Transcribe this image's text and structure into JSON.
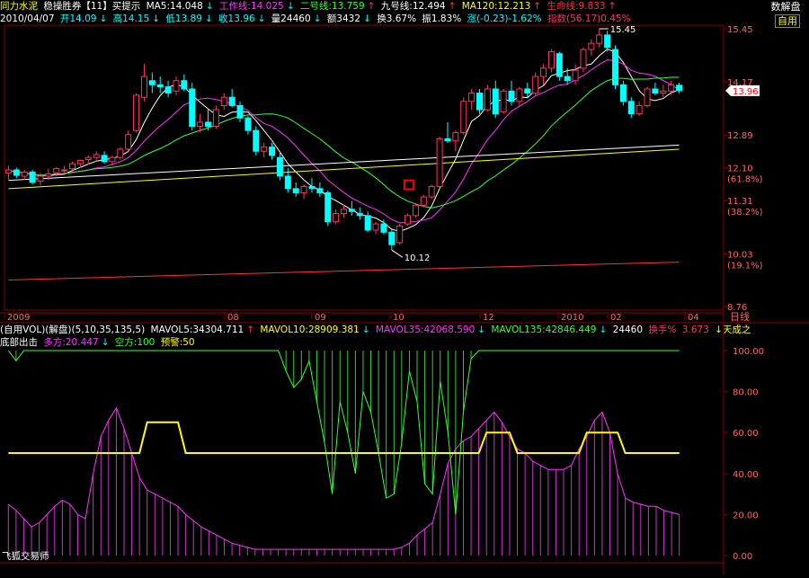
{
  "header": {
    "stock_name": "同力水泥",
    "indicator": "稳操胜券【11】买提示",
    "ma5": "MA5:14.048",
    "ma5_arrow": "↓",
    "gongzuo": "工作线:14.025",
    "gongzuo_arrow": "↓",
    "erhao": "二号线:13.759",
    "erhao_arrow": "↑",
    "jiuhao": "九号线:12.494",
    "jiuhao_arrow": "↑",
    "ma120": "MA120:12.213",
    "ma120_arrow": "↑",
    "shengming": "生命线:9.833",
    "shengming_arrow": "↑"
  },
  "quote": {
    "date": "2010/04/07",
    "open": "开14.09",
    "open_arrow": "↓",
    "high": "高14.15",
    "high_arrow": "↓",
    "low": "低13.89",
    "low_arrow": "↓",
    "close": "收13.96",
    "close_arrow": "↓",
    "volume": "量24460",
    "vol_arrow": "↓",
    "amount": "额3432",
    "amount_arrow": "↓",
    "turnover": "换3.67%",
    "amplitude": "振1.83%",
    "change": "涨(-0.23)-1.62%",
    "index": "指数(56.17)0.45%"
  },
  "vol_header": {
    "label": "(自用VOL)(解盘)(5,10,35,135,5)",
    "mavol5": "MAVOL5:34304.711",
    "mavol5_arrow": "↑",
    "mavol10": "MAVOL10:28909.381",
    "mavol10_arrow": "↓",
    "mavol35": "MAVOL35:42068.590",
    "mavol35_arrow": "↓",
    "mavol135": "MAVOL135:42846.449",
    "mavol135_arrow": "↓",
    "vol": "24460",
    "turn": "换手%",
    "turn_val": "3.673",
    "done": "↓天成之"
  },
  "sub_header": {
    "title": "底部出击",
    "duofang": "多方:20.447",
    "duofang_arrow": "↓",
    "kongfang": "空方:100",
    "yujing": "预警:50"
  },
  "buttons": {
    "zixuan": "自用",
    "jiepan": "数解盘"
  },
  "footer": {
    "brand": "飞狐交易师"
  },
  "colors": {
    "up": "#ff3366",
    "down": "#00ffff",
    "ma5": "#ffffff",
    "ma10": "#ff33ff",
    "ma20": "#33ff33",
    "ma60": "#ffffff",
    "ma120": "#ffff00",
    "life": "#ff3333",
    "grid": "#880000"
  },
  "chart_data": [
    {
      "type": "candlestick",
      "y_ticks": [
        "15.45",
        "14.17",
        "12.89",
        "12.10",
        "11.31",
        "10.03",
        "8.76"
      ],
      "y_pct": [
        "(61.8%)",
        "(38.2%)",
        "(19.1%)"
      ],
      "ylim": [
        8.76,
        15.45
      ],
      "x_ticks": [
        "2009",
        "08",
        "09",
        "10",
        "12",
        "2010",
        "02",
        "04"
      ],
      "x_unit": "日线",
      "current_price": "13.96",
      "annotations": {
        "high": "15.45",
        "low": "10.12"
      },
      "candles": [
        [
          11.98,
          12.15,
          11.82,
          12.05
        ],
        [
          12.05,
          12.1,
          11.85,
          11.92
        ],
        [
          11.9,
          12.05,
          11.8,
          12.0
        ],
        [
          12.0,
          12.05,
          11.7,
          11.75
        ],
        [
          11.78,
          11.98,
          11.68,
          11.9
        ],
        [
          11.9,
          12.08,
          11.8,
          11.95
        ],
        [
          11.98,
          12.12,
          11.9,
          12.08
        ],
        [
          12.05,
          12.15,
          11.95,
          12.05
        ],
        [
          12.08,
          12.25,
          12.0,
          12.2
        ],
        [
          12.2,
          12.3,
          12.1,
          12.28
        ],
        [
          12.3,
          12.4,
          12.18,
          12.35
        ],
        [
          12.35,
          12.5,
          12.25,
          12.42
        ],
        [
          12.4,
          12.5,
          12.2,
          12.25
        ],
        [
          12.25,
          12.4,
          12.15,
          12.35
        ],
        [
          12.35,
          12.6,
          12.3,
          12.55
        ],
        [
          12.55,
          13.0,
          12.5,
          12.9
        ],
        [
          13.0,
          13.9,
          12.95,
          13.85
        ],
        [
          13.8,
          14.6,
          13.7,
          14.3
        ],
        [
          14.2,
          14.4,
          13.9,
          14.1
        ],
        [
          14.1,
          14.3,
          13.9,
          14.05
        ],
        [
          14.05,
          14.2,
          13.8,
          13.9
        ],
        [
          13.95,
          14.3,
          13.85,
          14.2
        ],
        [
          14.2,
          14.35,
          13.95,
          14.0
        ],
        [
          14.0,
          14.15,
          13.0,
          13.1
        ],
        [
          13.1,
          13.4,
          12.95,
          13.2
        ],
        [
          13.2,
          13.5,
          13.0,
          13.1
        ],
        [
          13.1,
          13.6,
          13.05,
          13.5
        ],
        [
          13.6,
          13.9,
          13.5,
          13.8
        ],
        [
          13.8,
          14.0,
          13.55,
          13.6
        ],
        [
          13.6,
          13.7,
          13.2,
          13.3
        ],
        [
          13.3,
          13.35,
          12.9,
          13.0
        ],
        [
          13.0,
          13.1,
          12.4,
          12.5
        ],
        [
          12.5,
          12.7,
          12.35,
          12.6
        ],
        [
          12.6,
          12.7,
          12.3,
          12.4
        ],
        [
          12.35,
          12.5,
          11.8,
          11.9
        ],
        [
          11.9,
          12.1,
          11.5,
          11.6
        ],
        [
          11.6,
          11.75,
          11.4,
          11.5
        ],
        [
          11.5,
          11.7,
          11.35,
          11.65
        ],
        [
          11.65,
          11.85,
          11.5,
          11.6
        ],
        [
          11.6,
          11.75,
          11.4,
          11.5
        ],
        [
          11.5,
          11.55,
          10.7,
          10.8
        ],
        [
          10.8,
          11.1,
          10.75,
          11.0
        ],
        [
          11.0,
          11.2,
          10.9,
          11.1
        ],
        [
          11.1,
          11.3,
          10.95,
          11.05
        ],
        [
          11.0,
          11.15,
          10.85,
          10.95
        ],
        [
          10.95,
          11.05,
          10.55,
          10.6
        ],
        [
          10.6,
          10.8,
          10.5,
          10.75
        ],
        [
          10.75,
          10.85,
          10.5,
          10.55
        ],
        [
          10.55,
          10.65,
          10.12,
          10.25
        ],
        [
          10.3,
          10.75,
          10.25,
          10.7
        ],
        [
          10.75,
          11.0,
          10.7,
          10.95
        ],
        [
          10.95,
          11.25,
          10.9,
          11.2
        ],
        [
          11.2,
          11.45,
          11.15,
          11.4
        ],
        [
          11.4,
          11.7,
          11.35,
          11.65
        ],
        [
          11.65,
          12.85,
          11.6,
          12.8
        ],
        [
          12.8,
          13.2,
          12.7,
          12.75
        ],
        [
          12.75,
          13.0,
          12.5,
          12.95
        ],
        [
          12.95,
          13.8,
          12.9,
          13.7
        ],
        [
          13.7,
          14.0,
          13.5,
          13.9
        ],
        [
          13.9,
          14.0,
          13.4,
          13.5
        ],
        [
          13.5,
          14.1,
          13.45,
          14.0
        ],
        [
          14.0,
          14.2,
          13.3,
          13.4
        ],
        [
          13.45,
          14.0,
          13.4,
          13.95
        ],
        [
          13.95,
          14.2,
          13.6,
          13.7
        ],
        [
          13.7,
          14.05,
          13.6,
          14.0
        ],
        [
          14.0,
          14.15,
          13.8,
          13.9
        ],
        [
          13.9,
          14.4,
          13.85,
          14.3
        ],
        [
          14.3,
          14.6,
          14.1,
          14.5
        ],
        [
          14.5,
          14.95,
          14.4,
          14.9
        ],
        [
          14.85,
          14.9,
          14.2,
          14.3
        ],
        [
          14.3,
          14.5,
          14.1,
          14.2
        ],
        [
          14.2,
          14.6,
          14.1,
          14.45
        ],
        [
          14.5,
          15.0,
          14.4,
          14.95
        ],
        [
          14.95,
          15.2,
          14.8,
          15.1
        ],
        [
          15.1,
          15.45,
          15.0,
          15.3
        ],
        [
          15.3,
          15.4,
          14.9,
          15.0
        ],
        [
          14.95,
          15.05,
          14.0,
          14.1
        ],
        [
          14.1,
          14.2,
          13.6,
          13.7
        ],
        [
          13.7,
          13.8,
          13.3,
          13.4
        ],
        [
          13.4,
          13.7,
          13.35,
          13.6
        ],
        [
          13.6,
          14.05,
          13.55,
          14.0
        ],
        [
          14.0,
          14.15,
          13.85,
          13.9
        ],
        [
          13.9,
          14.1,
          13.8,
          13.95
        ],
        [
          13.95,
          14.2,
          13.85,
          14.1
        ],
        [
          14.09,
          14.15,
          13.89,
          13.96
        ]
      ]
    },
    {
      "type": "line",
      "title": "底部出击",
      "y_ticks": [
        "100.00",
        "80.00",
        "60.00",
        "40.00",
        "20.00",
        "0.00"
      ],
      "ylim": [
        0,
        100
      ],
      "series": [
        {
          "name": "多方",
          "values": [
            25,
            22,
            18,
            14,
            16,
            20,
            24,
            27,
            25,
            20,
            18,
            40,
            58,
            66,
            72,
            62,
            50,
            38,
            32,
            30,
            28,
            26,
            24,
            20,
            17,
            14,
            12,
            10,
            8,
            6,
            5,
            4,
            3,
            3,
            3,
            3,
            3,
            3,
            3,
            3,
            3,
            3,
            3,
            3,
            3,
            3,
            3,
            3,
            3,
            3,
            3,
            4,
            6,
            10,
            13,
            16,
            30,
            45,
            52,
            56,
            58,
            62,
            66,
            70,
            65,
            58,
            52,
            50,
            46,
            44,
            42,
            42,
            42,
            44,
            52,
            58,
            66,
            70,
            60,
            40,
            28,
            26,
            25,
            24,
            24,
            22,
            21,
            20
          ]
        },
        {
          "name": "空方",
          "values": [
            100,
            95,
            100,
            100,
            100,
            100,
            100,
            100,
            100,
            100,
            100,
            100,
            100,
            100,
            100,
            100,
            100,
            100,
            100,
            100,
            100,
            100,
            100,
            100,
            100,
            100,
            100,
            100,
            100,
            100,
            100,
            100,
            100,
            100,
            100,
            100,
            90,
            82,
            86,
            95,
            75,
            55,
            30,
            75,
            60,
            40,
            80,
            70,
            50,
            28,
            30,
            55,
            90,
            75,
            35,
            30,
            85,
            60,
            20,
            70,
            96,
            100,
            100,
            100,
            100,
            100,
            100,
            100,
            100,
            100,
            100,
            100,
            100,
            100,
            100,
            100,
            100,
            100,
            100,
            100,
            100,
            100,
            100,
            100,
            100,
            100,
            100,
            100
          ]
        },
        {
          "name": "预警",
          "values": [
            50,
            50,
            50,
            50,
            50,
            50,
            50,
            50,
            50,
            50,
            50,
            50,
            50,
            50,
            50,
            50,
            50,
            50,
            65,
            65,
            65,
            65,
            65,
            50,
            50,
            50,
            50,
            50,
            50,
            50,
            50,
            50,
            50,
            50,
            50,
            50,
            50,
            50,
            50,
            50,
            50,
            50,
            50,
            50,
            50,
            50,
            50,
            50,
            50,
            50,
            50,
            50,
            50,
            50,
            50,
            50,
            50,
            50,
            50,
            50,
            50,
            50,
            60,
            60,
            60,
            60,
            50,
            50,
            50,
            50,
            50,
            50,
            50,
            50,
            50,
            60,
            60,
            60,
            60,
            60,
            50,
            50,
            50,
            50,
            50,
            50,
            50,
            50
          ]
        }
      ]
    }
  ]
}
